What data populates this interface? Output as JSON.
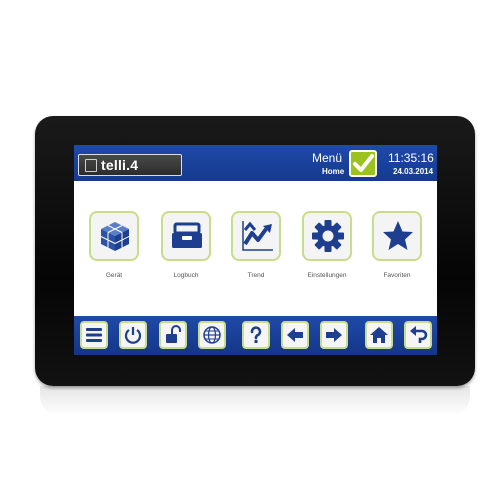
{
  "header": {
    "logo_text": "telli.4",
    "menu_title": "Menü",
    "menu_subtitle": "Home",
    "time": "11:35:16",
    "date": "24.03.2014"
  },
  "tiles": [
    {
      "label": "Gerät",
      "icon": "cube-icon"
    },
    {
      "label": "Logbuch",
      "icon": "logbook-drawer-icon"
    },
    {
      "label": "Trend",
      "icon": "trend-chart-icon"
    },
    {
      "label": "Einstellungen",
      "icon": "gear-icon"
    },
    {
      "label": "Favoriten",
      "icon": "star-icon"
    }
  ],
  "toolbar": [
    {
      "icon": "menu-icon"
    },
    {
      "icon": "power-icon"
    },
    {
      "icon": "unlock-icon"
    },
    {
      "icon": "globe-icon"
    },
    {
      "icon": "help-icon"
    },
    {
      "icon": "arrow-left-icon"
    },
    {
      "icon": "arrow-right-icon"
    },
    {
      "icon": "home-icon"
    },
    {
      "icon": "back-icon"
    }
  ],
  "colors": {
    "header_blue": "#1f4aa8",
    "icon_blue": "#1e3f8f",
    "accent_green": "#9cc31d",
    "tile_border": "#c7dd8a",
    "bezel": "#0d0d0d"
  }
}
